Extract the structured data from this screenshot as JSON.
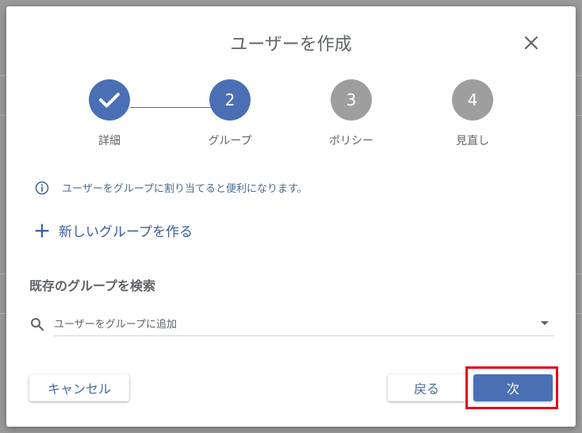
{
  "dialog": {
    "title": "ユーザーを作成",
    "close_icon": "close-icon"
  },
  "stepper": {
    "steps": [
      {
        "number": "",
        "label": "詳細",
        "state": "done",
        "icon": "check-icon"
      },
      {
        "number": "2",
        "label": "グループ",
        "state": "active"
      },
      {
        "number": "3",
        "label": "ポリシー",
        "state": "todo"
      },
      {
        "number": "4",
        "label": "見直し",
        "state": "todo"
      }
    ]
  },
  "info": {
    "icon": "info-icon",
    "text": "ユーザーをグループに割り当てると便利になります。"
  },
  "create_group": {
    "icon": "plus-icon",
    "label": "新しいグループを作る"
  },
  "search_section": {
    "title": "既存のグループを検索",
    "icon": "search-icon",
    "placeholder": "ユーザーをグループに追加",
    "value": ""
  },
  "footer": {
    "cancel_label": "キャンセル",
    "back_label": "戻る",
    "next_label": "次"
  },
  "colors": {
    "primary": "#4a6fb5",
    "inactive_step": "#9e9e9e",
    "highlight": "#e3001b"
  }
}
